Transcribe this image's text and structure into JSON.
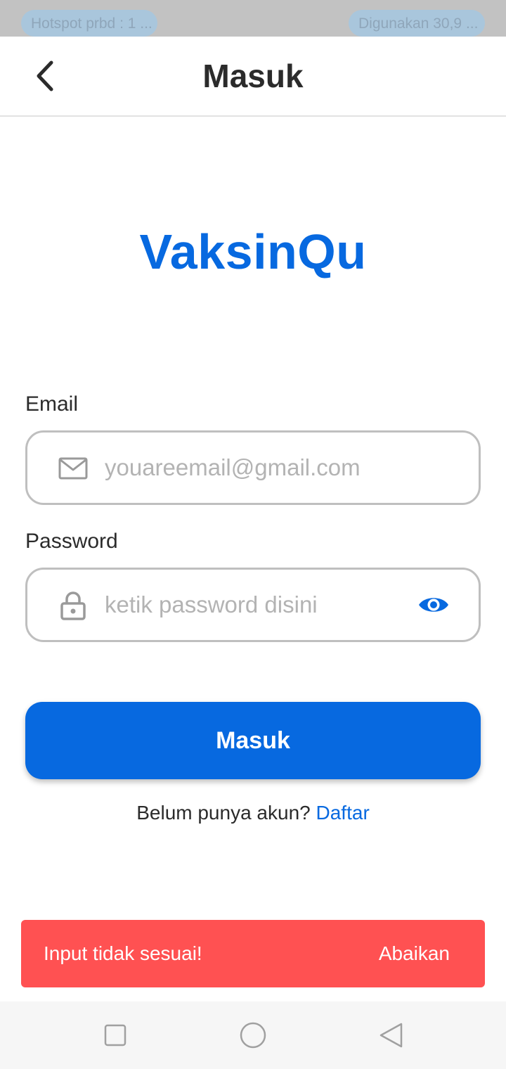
{
  "status_bar": {
    "left_text": "Hotspot prbd : 1 ...",
    "right_text": "Digunakan 30,9 ..."
  },
  "header": {
    "back_icon": "chevron-left-icon",
    "title": "Masuk"
  },
  "logo": {
    "text": "VaksinQu"
  },
  "form": {
    "email": {
      "label": "Email",
      "icon": "mail-icon",
      "value": "",
      "placeholder": "youareemail@gmail.com"
    },
    "password": {
      "label": "Password",
      "icon": "lock-icon",
      "value": "",
      "placeholder": "ketik password disini",
      "toggle_icon": "eye-icon"
    },
    "submit_label": "Masuk",
    "register_prompt": "Belum punya akun?",
    "register_link": "Daftar"
  },
  "snackbar": {
    "message": "Input tidak sesuai!",
    "action": "Abaikan"
  },
  "nav_bar": {
    "recents_icon": "square-icon",
    "home_icon": "circle-icon",
    "back_icon": "triangle-back-icon"
  },
  "colors": {
    "primary": "#0769e0",
    "error": "#ff5152",
    "border": "#bfbfbf",
    "text": "#2b2b2b",
    "placeholder": "#b3b3b3"
  }
}
